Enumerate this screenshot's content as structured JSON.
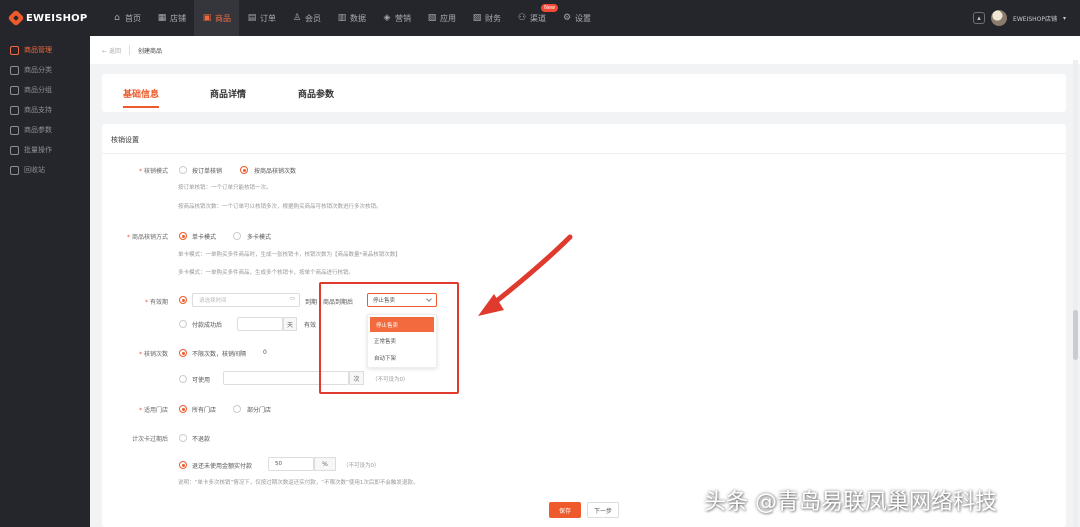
{
  "brand": {
    "name": "EWEISHOP",
    "accent": "#ee5a2c"
  },
  "topnav": {
    "items": [
      {
        "label": "首页",
        "icon": "home-icon"
      },
      {
        "label": "店铺",
        "icon": "store-icon"
      },
      {
        "label": "商品",
        "icon": "product-icon",
        "active": true
      },
      {
        "label": "订单",
        "icon": "order-icon"
      },
      {
        "label": "会员",
        "icon": "member-icon"
      },
      {
        "label": "数据",
        "icon": "data-icon"
      },
      {
        "label": "营销",
        "icon": "tag-icon"
      },
      {
        "label": "应用",
        "icon": "app-icon"
      },
      {
        "label": "财务",
        "icon": "finance-icon"
      },
      {
        "label": "渠道",
        "icon": "channel-icon",
        "badge": "New"
      },
      {
        "label": "设置",
        "icon": "gear-icon"
      }
    ],
    "user": "EWEISHOP店铺"
  },
  "sidebar": {
    "items": [
      {
        "label": "商品管理",
        "active": true
      },
      {
        "label": "商品分类"
      },
      {
        "label": "商品分组"
      },
      {
        "label": "商品支持"
      },
      {
        "label": "商品参数"
      },
      {
        "label": "批量操作"
      },
      {
        "label": "回收站"
      }
    ]
  },
  "breadcrumb": {
    "back": "返回",
    "current": "创建商品"
  },
  "tabs": [
    "基础信息",
    "商品详情",
    "商品参数"
  ],
  "card": {
    "title": "核销设置",
    "mode": {
      "label": "核销模式",
      "options": [
        "按订单核销",
        "按商品核销次数"
      ],
      "hint1": "按订单核销：一个订单只能核销一次。",
      "hint2": "按商品核销次数：一个订单可以核销多次，根据购买商品可核销次数进行多次核销。"
    },
    "card_mode": {
      "label": "商品核销方式",
      "options": [
        "单卡模式",
        "多卡模式"
      ],
      "hint1": "单卡模式：一单购买多件商品时，生成一张核销卡，核销次数为【商品数量*商品核销次数】",
      "hint2": "多卡模式：一单购买多件商品，生成多个核销卡，按单个商品进行核销。"
    },
    "validity": {
      "label": "有效期",
      "date_placeholder": "请选择时间",
      "to": "到期",
      "after_label": "商品到期后",
      "selected": "停止售卖",
      "options": [
        "停止售卖",
        "正常售卖",
        "自动下架"
      ],
      "days_label": "付款成功后",
      "days_unit": "天",
      "days_suffix": "有效"
    },
    "count": {
      "label": "核销次数",
      "opt1": "不限次数，核销间隔",
      "opt1_value": "0",
      "opt2": "可使用",
      "opt2_unit": "次",
      "opt2_hint": "（不可设为0）"
    },
    "stores": {
      "label": "适用门店",
      "options": [
        "所有门店",
        "部分门店"
      ]
    },
    "expire": {
      "label": "计次卡过期后",
      "opt1": "不退款",
      "opt2": "退还未使用金额实付款",
      "percent": "50",
      "percent_unit": "%",
      "percent_hint": "（不可设为0）",
      "note": "说明：“单卡多次核销”情况下，仅按过期次数返还实付款，“不限次数”使用1次后即不会触发退款。"
    }
  },
  "buttons": {
    "save": "保存",
    "next": "下一步"
  },
  "watermark": "头条 @青岛易联凤巢网络科技"
}
